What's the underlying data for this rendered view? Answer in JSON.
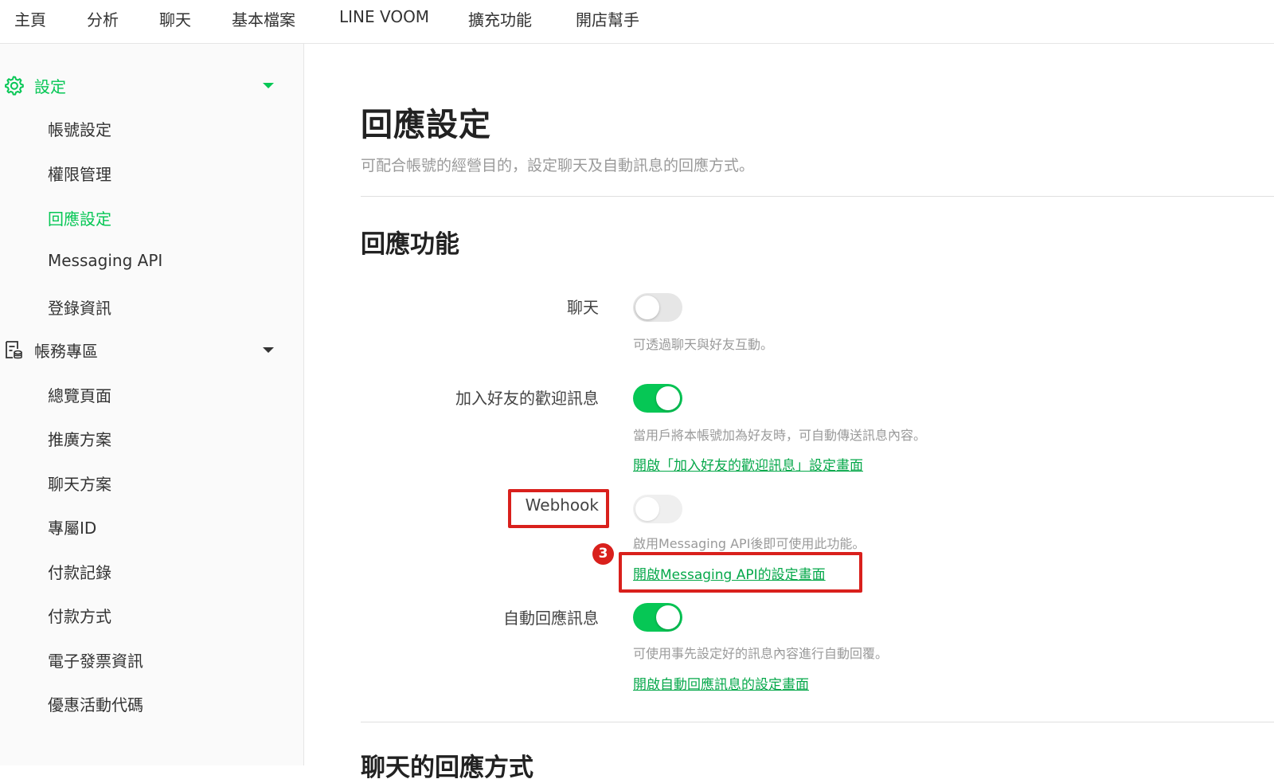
{
  "topnav": {
    "items": [
      "主頁",
      "分析",
      "聊天",
      "基本檔案",
      "LINE VOOM",
      "擴充功能",
      "開店幫手"
    ]
  },
  "sidebar": {
    "settings": {
      "label": "設定",
      "icon": "gear-icon",
      "items": [
        "帳號設定",
        "權限管理",
        "回應設定",
        "Messaging API",
        "登錄資訊"
      ],
      "active_item": "回應設定"
    },
    "account": {
      "label": "帳務專區",
      "icon": "billing-document-icon",
      "items": [
        "總覽頁面",
        "推廣方案",
        "聊天方案",
        "專屬ID",
        "付款記錄",
        "付款方式",
        "電子發票資訊",
        "優惠活動代碼"
      ]
    }
  },
  "main": {
    "title": "回應設定",
    "description": "可配合帳號的經營目的，設定聊天及自動訊息的回應方式。",
    "section_title": "回應功能",
    "rows": {
      "chat": {
        "label": "聊天",
        "enabled": false,
        "help": "可透過聊天與好友互動。"
      },
      "welcome": {
        "label": "加入好友的歡迎訊息",
        "enabled": true,
        "help": "當用戶將本帳號加為好友時，可自動傳送訊息內容。",
        "link": "開啟「加入好友的歡迎訊息」設定畫面"
      },
      "webhook": {
        "label": "Webhook",
        "enabled": false,
        "disabled": true,
        "help": "啟用Messaging API後即可使用此功能。",
        "link": "開啟Messaging API的設定畫面"
      },
      "auto_reply": {
        "label": "自動回應訊息",
        "enabled": true,
        "help": "可使用事先設定好的訊息內容進行自動回覆。",
        "link": "開啟自動回應訊息的設定畫面"
      }
    },
    "step_badge": "3",
    "next_section_title": "聊天的回應方式"
  },
  "colors": {
    "accent": "#06c755",
    "annotation": "#d9201c"
  }
}
